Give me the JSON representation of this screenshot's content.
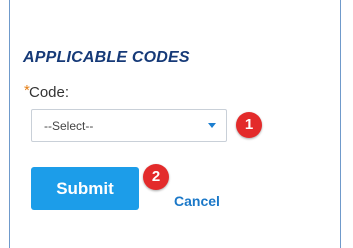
{
  "section": {
    "title": "APPLICABLE CODES"
  },
  "code_field": {
    "required_marker": "*",
    "label": "Code:",
    "select_value": "--Select--"
  },
  "callouts": {
    "first": "1",
    "second": "2"
  },
  "actions": {
    "submit_label": "Submit",
    "cancel_label": "Cancel"
  },
  "colors": {
    "accent": "#1c9de9",
    "link": "#1b78c8",
    "title": "#163a78",
    "required": "#e57e14",
    "callout": "#e32b2b",
    "panel_border": "#6f9acb"
  },
  "icons": {
    "select_arrow": "chevron-down-icon"
  }
}
